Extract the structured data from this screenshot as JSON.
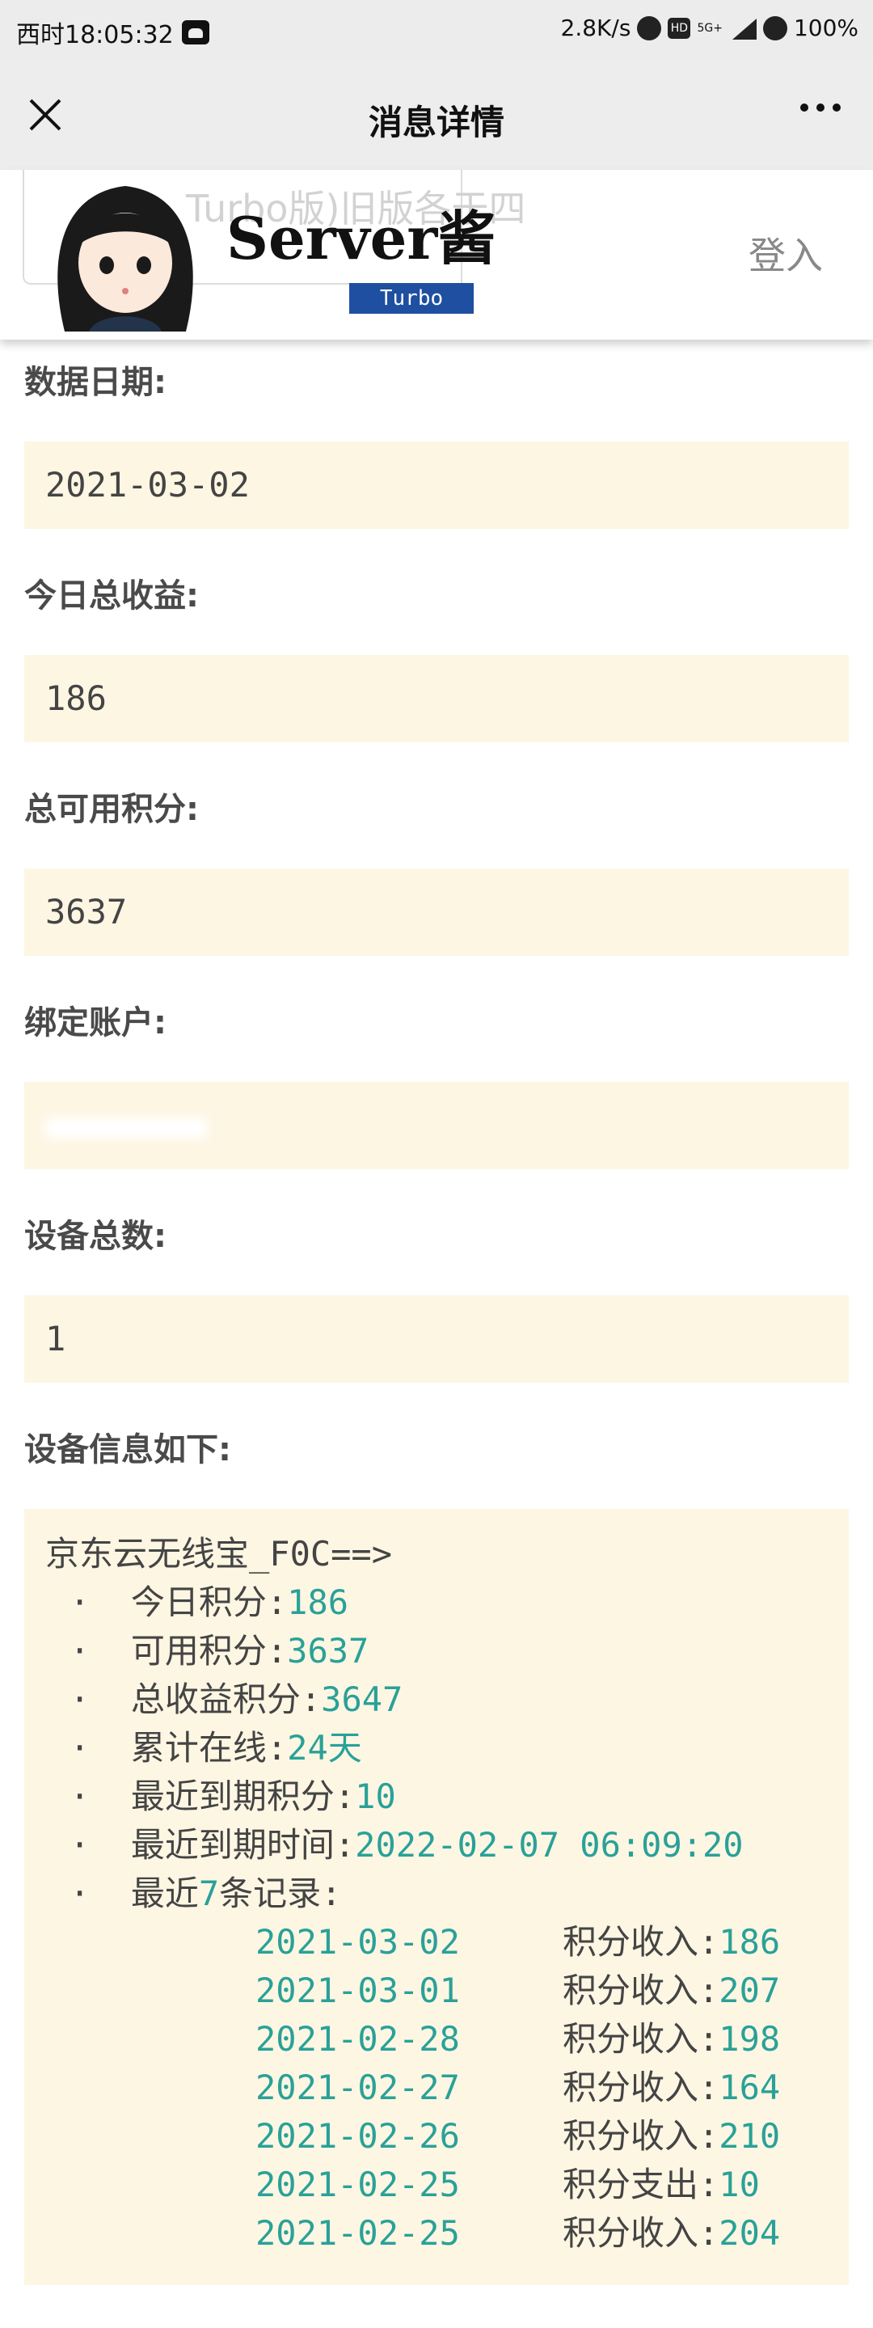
{
  "status_bar": {
    "time": "西时18:05:32",
    "speed": "2.8K/s",
    "hd": "HD",
    "net": "5G+",
    "battery": "100%"
  },
  "nav": {
    "title": "消息详情"
  },
  "header": {
    "ghost_text": "Turbo版)旧版各于四",
    "brand": "Server酱",
    "badge": "Turbo",
    "login": "登入"
  },
  "fields": [
    {
      "label": "数据日期:",
      "value": "2021-03-02"
    },
    {
      "label": "今日总收益:",
      "value": "186"
    },
    {
      "label": "总可用积分:",
      "value": "3637"
    },
    {
      "label": "绑定账户:",
      "value": ""
    },
    {
      "label": "设备总数:",
      "value": "1"
    }
  ],
  "device_section": {
    "label": "设备信息如下:",
    "device_name": "京东云无线宝_F0C==>",
    "stats": [
      {
        "key": "今日积分:",
        "val": "186"
      },
      {
        "key": "可用积分:",
        "val": "3637"
      },
      {
        "key": "总收益积分:",
        "val": "3647"
      },
      {
        "key": "累计在线:",
        "val": "24天"
      },
      {
        "key": "最近到期积分:",
        "val": "10"
      },
      {
        "key": "最近到期时间:",
        "val": "2022-02-07 06:09:20"
      }
    ],
    "records_prefix": "最近",
    "records_count": "7",
    "records_suffix": "条记录:",
    "records": [
      {
        "date": "2021-03-02",
        "type": "积分收入:",
        "amount": "186"
      },
      {
        "date": "2021-03-01",
        "type": "积分收入:",
        "amount": "207"
      },
      {
        "date": "2021-02-28",
        "type": "积分收入:",
        "amount": "198"
      },
      {
        "date": "2021-02-27",
        "type": "积分收入:",
        "amount": "164"
      },
      {
        "date": "2021-02-26",
        "type": "积分收入:",
        "amount": "210"
      },
      {
        "date": "2021-02-25",
        "type": "积分支出:",
        "amount": "10"
      },
      {
        "date": "2021-02-25",
        "type": "积分收入:",
        "amount": "204"
      }
    ]
  },
  "colors": {
    "box_bg": "#fdf6e3",
    "accent": "#2aa198",
    "badge": "#1e4fa0"
  }
}
